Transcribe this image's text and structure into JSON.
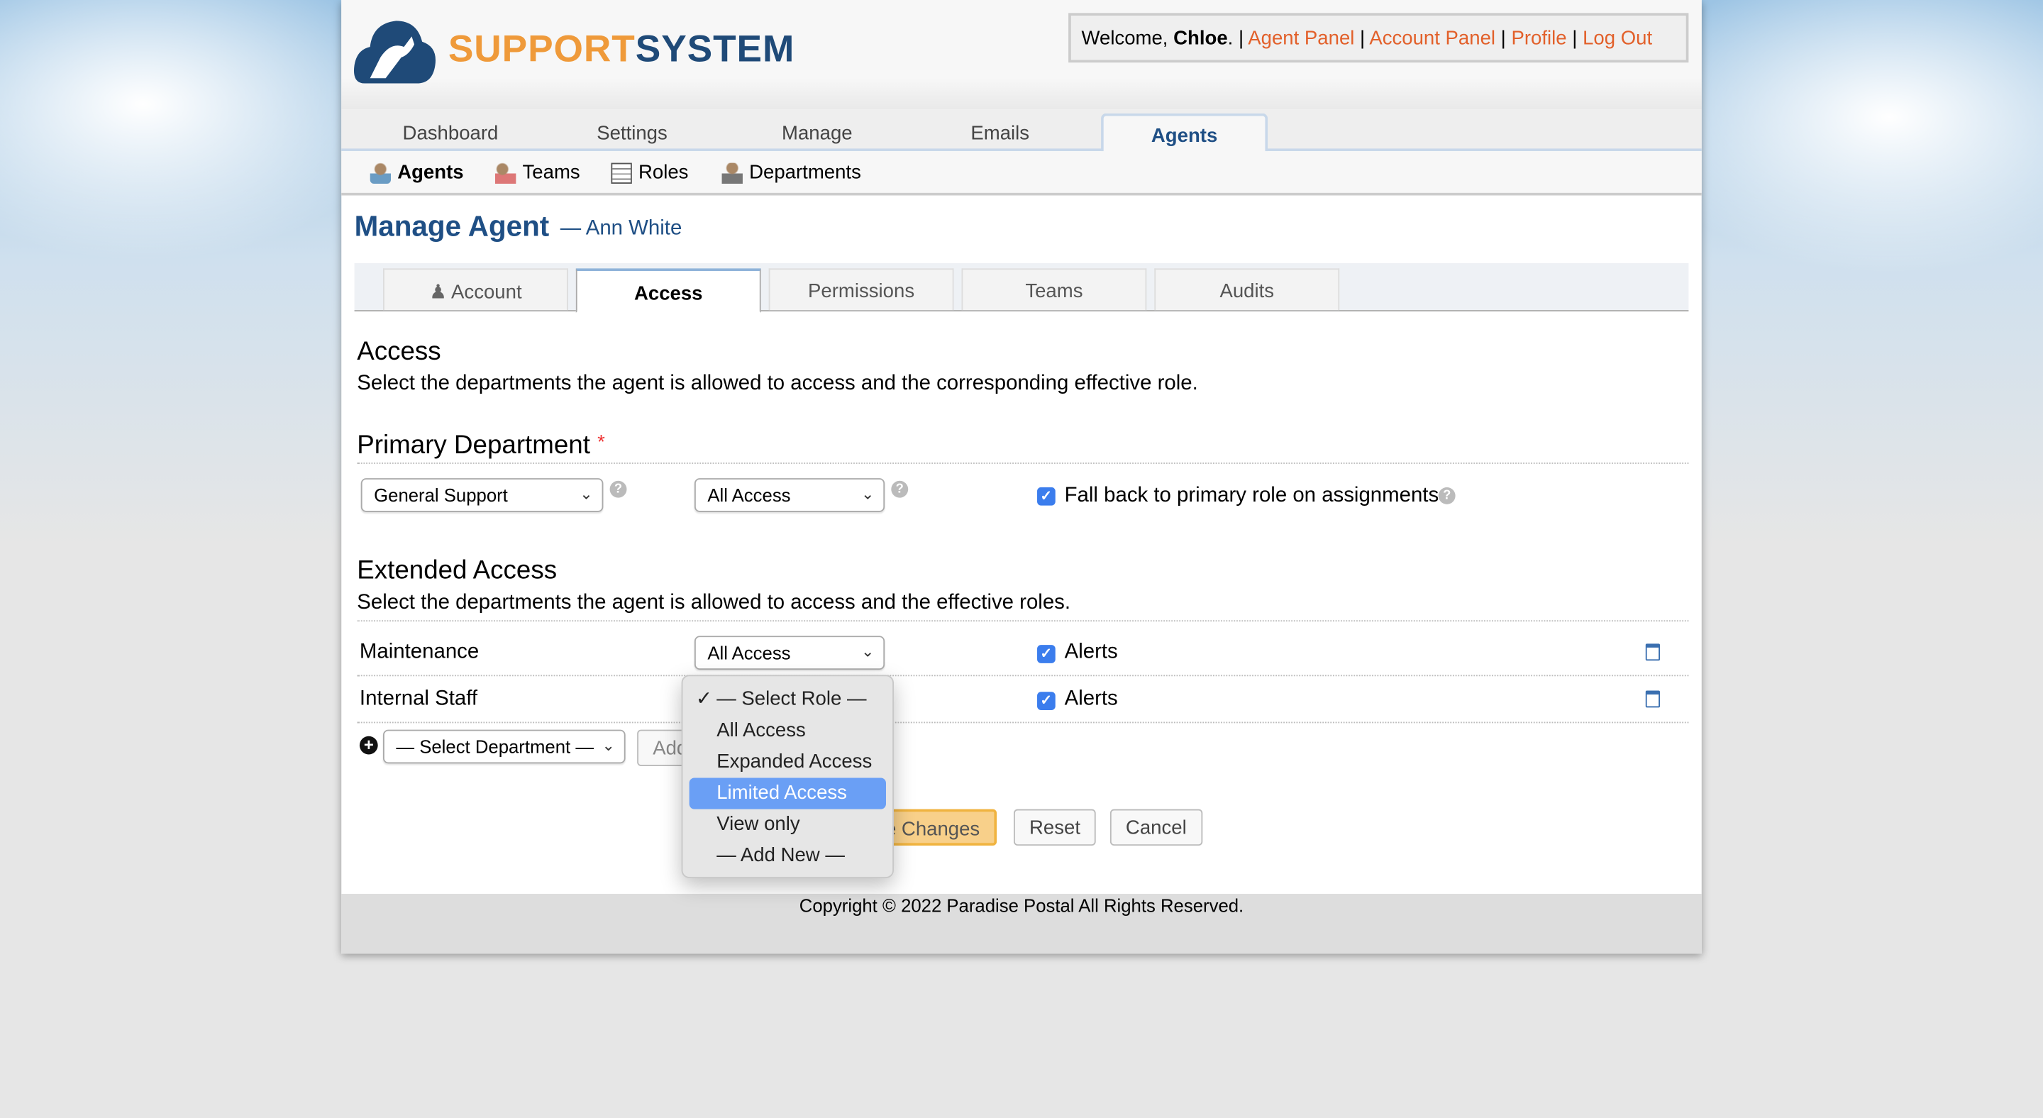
{
  "header": {
    "logo_part1": "SUPPORT",
    "logo_part2": "SYSTEM",
    "welcome_prefix": "Welcome, ",
    "user": "Chloe",
    "links": [
      "Agent Panel",
      "Account Panel",
      "Profile",
      "Log Out"
    ]
  },
  "nav": {
    "tabs": [
      "Dashboard",
      "Settings",
      "Manage",
      "Emails",
      "Agents"
    ],
    "active": "Agents"
  },
  "subnav": [
    "Agents",
    "Teams",
    "Roles",
    "Departments"
  ],
  "page": {
    "title": "Manage Agent",
    "subtitle": "— Ann White"
  },
  "tabs": [
    "Account",
    "Access",
    "Permissions",
    "Teams",
    "Audits"
  ],
  "access": {
    "heading": "Access",
    "description": "Select the departments the agent is allowed to access and the corresponding effective role."
  },
  "primary": {
    "heading": "Primary Department",
    "required": "*",
    "department": "General Support",
    "role": "All Access",
    "fallback_label": "Fall back to primary role on assignments",
    "fallback_checked": true
  },
  "extended": {
    "heading": "Extended Access",
    "description": "Select the departments the agent is allowed to access and the effective roles.",
    "rows": [
      {
        "department": "Maintenance",
        "role": "All Access",
        "alerts": "Alerts"
      },
      {
        "department": "Internal Staff",
        "role": "— Select Role —",
        "alerts": "Alerts"
      }
    ],
    "add_select": "— Select Department —",
    "add_button": "Add"
  },
  "dropdown": {
    "options": [
      "— Select Role —",
      "All Access",
      "Expanded Access",
      "Limited Access",
      "View only",
      "— Add New —"
    ],
    "checked": "— Select Role —",
    "highlighted": "Limited Access",
    "check": "✓"
  },
  "buttons": {
    "save": "Save Changes",
    "save_visible": "e Changes",
    "reset": "Reset",
    "cancel": "Cancel"
  },
  "footer": "Copyright © 2022 Paradise Postal All Rights Reserved.",
  "colors": {
    "brand_blue": "#1f4f85",
    "brand_orange": "#ef9a3a",
    "link": "#e2602a",
    "highlight": "#6a9ff5",
    "save": "#f8d08a"
  }
}
